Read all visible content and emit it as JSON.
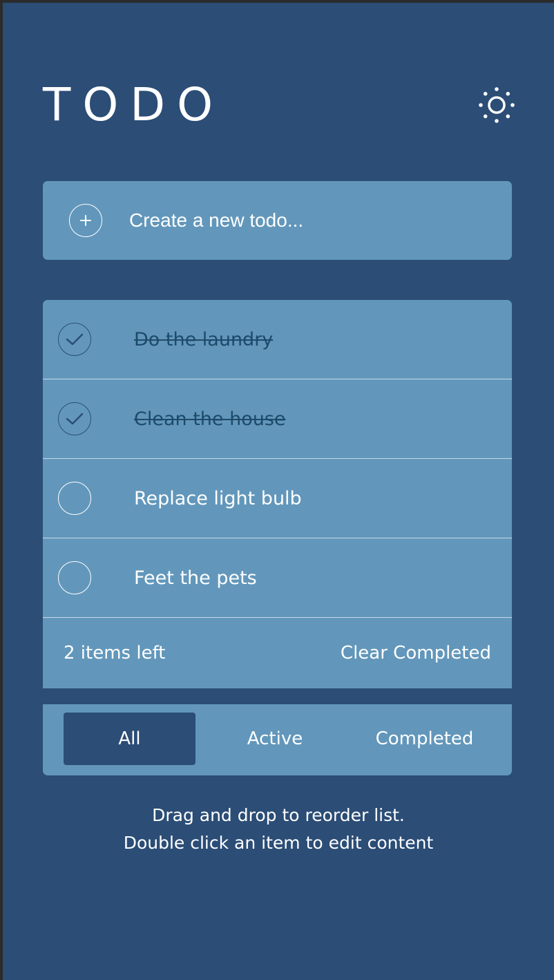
{
  "app": {
    "title": "TODO"
  },
  "create": {
    "placeholder": "Create a new todo..."
  },
  "todos": [
    {
      "label": "Do the laundry",
      "completed": true
    },
    {
      "label": "Clean the house",
      "completed": true
    },
    {
      "label": "Replace light bulb",
      "completed": false
    },
    {
      "label": "Feet the pets",
      "completed": false
    }
  ],
  "footer": {
    "items_left": "2 items left",
    "clear_label": "Clear Completed"
  },
  "filters": {
    "all": "All",
    "active": "Active",
    "completed": "Completed",
    "selected": "All"
  },
  "hint": {
    "line1": "Drag and drop to reorder list.",
    "line2": "Double click an item to edit content"
  },
  "colors": {
    "background": "#2b4d76",
    "panel": "#6297bb",
    "completed_text": "#1e4a6a"
  },
  "icons": {
    "theme": "sun-icon",
    "add": "plus-icon",
    "check": "check-icon"
  }
}
